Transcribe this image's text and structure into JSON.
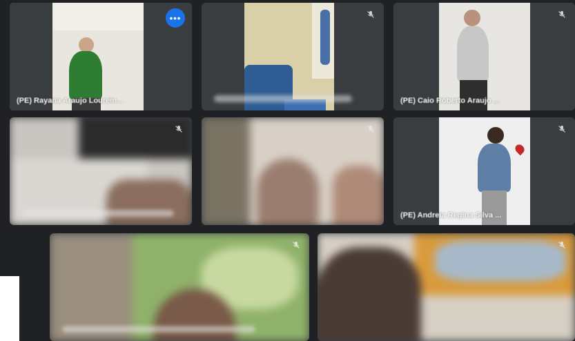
{
  "tiles": [
    {
      "name": "(PE) Rayana Araujo Lourein...",
      "more_label": "•••"
    },
    {
      "name": ""
    },
    {
      "name": "(PE) Caio Roberto Araujo ..."
    },
    {
      "name": ""
    },
    {
      "name": ""
    },
    {
      "name": "(PE) Andreia Regina Silva ..."
    },
    {
      "name": ""
    },
    {
      "name": ""
    }
  ],
  "icons": {
    "mic_off": "mic-off-icon",
    "more": "more-options-icon"
  },
  "colors": {
    "background": "#202124",
    "tile": "#3c4043",
    "active_border": "#5b8def",
    "more_button": "#1a73e8"
  }
}
